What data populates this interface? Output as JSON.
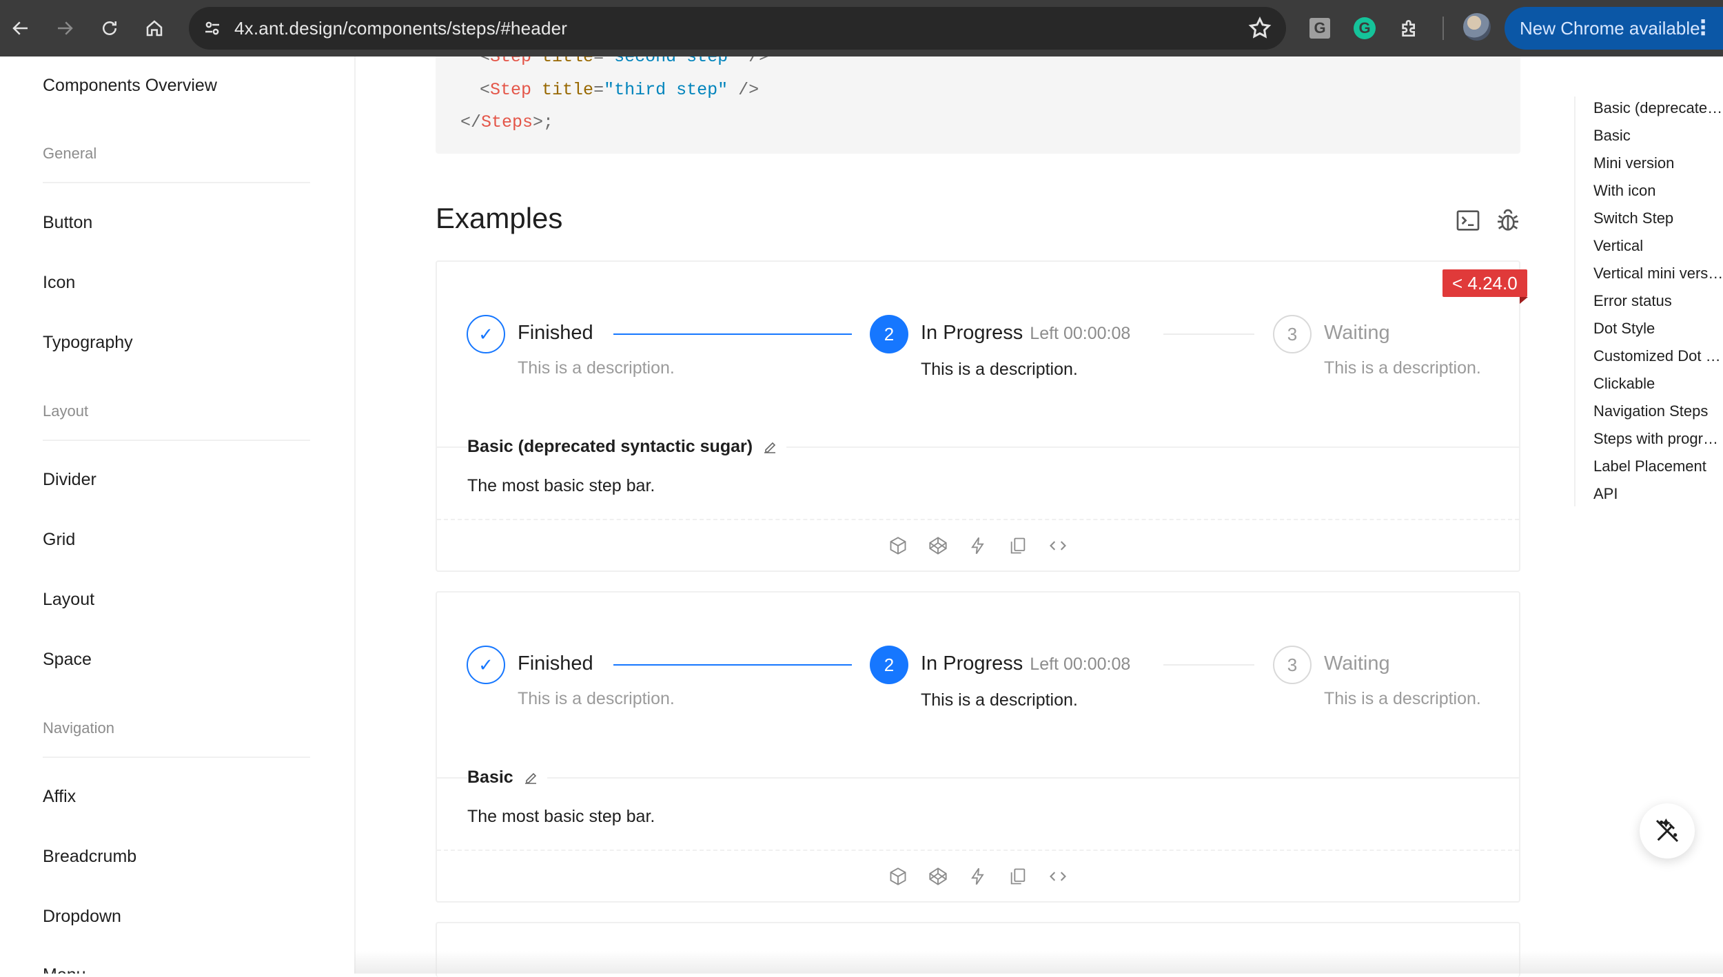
{
  "browser": {
    "url": "4x.ant.design/components/steps/#header",
    "update_label": "New Chrome available",
    "menu_glyph": "⋮",
    "ext_grammar_g": "G",
    "ext_grammarly_g": "G"
  },
  "sidebar": {
    "items": [
      {
        "label": "Components Overview"
      },
      {
        "group": "General"
      },
      {
        "label": "Button"
      },
      {
        "label": "Icon"
      },
      {
        "label": "Typography"
      },
      {
        "group": "Layout"
      },
      {
        "label": "Divider"
      },
      {
        "label": "Grid"
      },
      {
        "label": "Layout"
      },
      {
        "label": "Space"
      },
      {
        "group": "Navigation"
      },
      {
        "label": "Affix"
      },
      {
        "label": "Breadcrumb"
      },
      {
        "label": "Dropdown"
      },
      {
        "label": "Menu"
      }
    ]
  },
  "code": {
    "line1_tag": "Step",
    "line1_attr": "title",
    "line1_val": "\"second step\"",
    "line2_tag": "Step",
    "line2_attr": "title",
    "line2_val": "\"third step\"",
    "line3_tag": "Steps"
  },
  "main": {
    "section_title": "Examples",
    "version_badge": "< 4.24.0",
    "examples": [
      {
        "title": "Basic (deprecated syntactic sugar)",
        "description": "The most basic step bar.",
        "steps": [
          {
            "icon": "✓",
            "title": "Finished",
            "subtitle": "",
            "description": "This is a description."
          },
          {
            "icon": "2",
            "title": "In Progress",
            "subtitle": "Left 00:00:08",
            "description": "This is a description."
          },
          {
            "icon": "3",
            "title": "Waiting",
            "subtitle": "",
            "description": "This is a description."
          }
        ]
      },
      {
        "title": "Basic",
        "description": "The most basic step bar.",
        "steps": [
          {
            "icon": "✓",
            "title": "Finished",
            "subtitle": "",
            "description": "This is a description."
          },
          {
            "icon": "2",
            "title": "In Progress",
            "subtitle": "Left 00:00:08",
            "description": "This is a description."
          },
          {
            "icon": "3",
            "title": "Waiting",
            "subtitle": "",
            "description": "This is a description."
          }
        ]
      }
    ]
  },
  "anchor": {
    "items": [
      "Basic (deprecated syntactic sugar)",
      "Basic",
      "Mini version",
      "With icon",
      "Switch Step",
      "Vertical",
      "Vertical mini version",
      "Error status",
      "Dot Style",
      "Customized Dot Style",
      "Clickable",
      "Navigation Steps",
      "Steps with progress",
      "Label Placement",
      "API"
    ]
  },
  "colors": {
    "primary": "#1677ff",
    "badge": "#e03a3a",
    "chrome_bg": "#3c3c3c",
    "update_button": "#0b57a6"
  },
  "icons": {
    "back": "arrow-left-icon",
    "forward": "arrow-right-icon",
    "reload": "reload-icon",
    "home": "home-icon",
    "site_info": "tune-icon",
    "bookmark": "star-icon",
    "extensions": "puzzle-icon",
    "codesandbox": "codesandbox-icon",
    "codepen": "codepen-icon",
    "stackblitz": "thunderbolt-icon",
    "copy": "copy-icon",
    "code": "code-icon",
    "terminal": "terminal-icon",
    "bug": "bug-icon",
    "theme": "magic-wand-icon"
  }
}
